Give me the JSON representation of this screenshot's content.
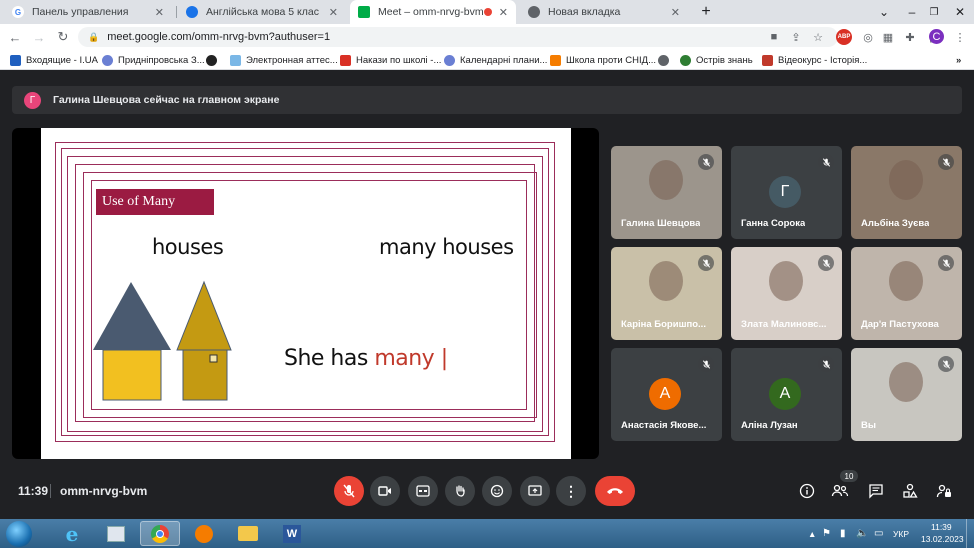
{
  "browser": {
    "tabs": [
      {
        "label": "Панель управления",
        "icon": "google-icon"
      },
      {
        "label": "Англійська мова 5 клас",
        "icon": "classroom-icon"
      },
      {
        "label": "Meet – omm-nrvg-bvm",
        "icon": "meet-icon",
        "active": true
      },
      {
        "label": "Новая вкладка",
        "icon": "chrome-icon"
      }
    ],
    "url": "meet.google.com/omm-nrvg-bvm?authuser=1",
    "profile_initial": "C",
    "abp_label": "ABP",
    "bookmarks": [
      {
        "label": "Входящие - I.UA",
        "color": "#1f5fbf"
      },
      {
        "label": "Придніпровська З...",
        "color": "#6a7fd3"
      },
      {
        "label": "",
        "color": "#222222"
      },
      {
        "label": "Электронная аттес...",
        "color": "#7ab7e6"
      },
      {
        "label": "Накази по школі -...",
        "color": "#d93025"
      },
      {
        "label": "Календарні плани...",
        "color": "#6a7fd3"
      },
      {
        "label": "Школа проти СНІД...",
        "color": "#f57c00"
      },
      {
        "label": "",
        "color": "#5f6368"
      },
      {
        "label": "Острів знань",
        "color": "#2e7d32"
      },
      {
        "label": "Відеокурс - Історія...",
        "color": "#c0392b"
      }
    ]
  },
  "meet": {
    "presenter_initial": "Г",
    "presenting_banner": "Галина Шевцова сейчас на главном экране",
    "slide": {
      "title": "Use of Many",
      "word1": "houses",
      "word2": "many houses",
      "sentence_a": "She has ",
      "sentence_b": "many ",
      "sentence_c": "|"
    },
    "participants": [
      {
        "name": "Галина Шевцова",
        "video": true,
        "bg": "#9c958c"
      },
      {
        "name": "Ганна Сорока",
        "initial": "Г",
        "avatar_color": "#455a64"
      },
      {
        "name": "Альбіна Зуєва",
        "video": true,
        "bg": "#8a7868"
      },
      {
        "name": "Каріна Боришпо...",
        "video": true,
        "bg": "#c9c0a8"
      },
      {
        "name": "Злата Малиновс...",
        "video": true,
        "bg": "#d8cfc8"
      },
      {
        "name": "Дар'я Пастухова",
        "video": true,
        "bg": "#bfb5ab"
      },
      {
        "name": "Анастасія Якове...",
        "initial": "А",
        "avatar_color": "#ef6c00"
      },
      {
        "name": "Аліна Лузан",
        "initial": "А",
        "avatar_color": "#33691e"
      },
      {
        "name": "Вы",
        "video": true,
        "bg": "#c8c6c0"
      }
    ],
    "time": "11:39",
    "meeting_code": "omm-nrvg-bvm",
    "people_count": "10"
  },
  "taskbar": {
    "lang": "УКР",
    "time": "11:39",
    "date": "13.02.2023"
  }
}
